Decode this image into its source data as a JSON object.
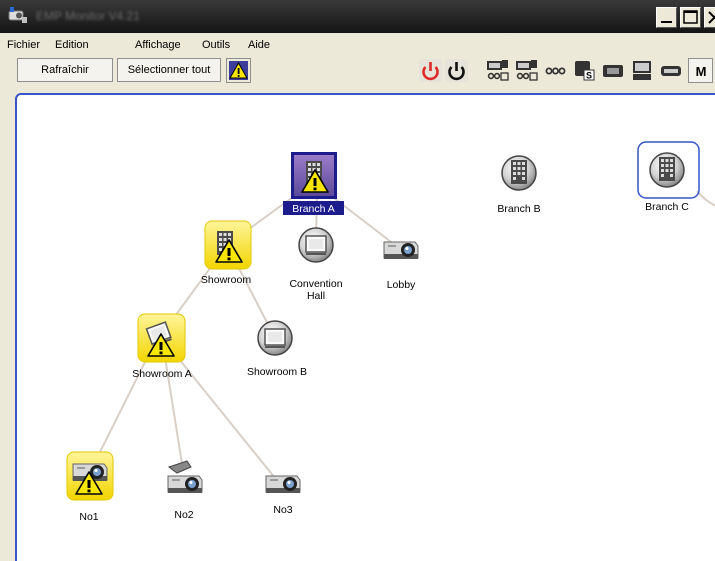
{
  "window": {
    "title": "EMP Monitor V4.21"
  },
  "menu": {
    "items": [
      "Fichier",
      "Edition",
      "Affichage",
      "Outils",
      "Aide"
    ]
  },
  "toolbar": {
    "refresh_label": "Rafraîchir",
    "select_all_label": "Sélectionner tout",
    "icons": [
      "warning-icon",
      "power-on-icon",
      "power-off-icon",
      "input1-icon",
      "input2-icon",
      "av-mute-icon",
      "source-s-icon",
      "source-video-icon",
      "source-computer-icon",
      "source-dvi-icon",
      "menu-m-icon"
    ]
  },
  "nodes": [
    {
      "id": "branch-a",
      "label": "Branch A",
      "kind": "group",
      "state": "warning-selected"
    },
    {
      "id": "branch-b",
      "label": "Branch B",
      "kind": "group",
      "state": "normal"
    },
    {
      "id": "branch-c",
      "label": "Branch C",
      "kind": "group",
      "state": "focused"
    },
    {
      "id": "showroom",
      "label": "Showroom",
      "kind": "group",
      "state": "warning"
    },
    {
      "id": "convention-hall",
      "label": "Convention Hall",
      "label_lines": [
        "Convention",
        "Hall"
      ],
      "kind": "screen",
      "state": "normal"
    },
    {
      "id": "lobby",
      "label": "Lobby",
      "kind": "projector",
      "state": "normal"
    },
    {
      "id": "showroom-a",
      "label": "Showroom A",
      "kind": "screen",
      "state": "warning"
    },
    {
      "id": "showroom-b",
      "label": "Showroom B",
      "kind": "screen",
      "state": "normal"
    },
    {
      "id": "no1",
      "label": "No1",
      "kind": "projector",
      "state": "warning"
    },
    {
      "id": "no2",
      "label": "No2",
      "kind": "projector-camera",
      "state": "normal"
    },
    {
      "id": "no3",
      "label": "No3",
      "kind": "projector",
      "state": "normal"
    }
  ],
  "edges": [
    [
      "branch-a",
      "showroom"
    ],
    [
      "branch-a",
      "convention-hall"
    ],
    [
      "branch-a",
      "lobby"
    ],
    [
      "showroom",
      "showroom-a"
    ],
    [
      "showroom",
      "showroom-b"
    ],
    [
      "showroom-a",
      "no1"
    ],
    [
      "showroom-a",
      "no2"
    ],
    [
      "showroom-a",
      "no3"
    ],
    [
      "branch-c",
      "offscreen"
    ]
  ],
  "colors": {
    "selection": "#1c1c8c",
    "warning_frame": "#f7e600",
    "focus_frame": "#3454c8",
    "edge": "#d9cfc7",
    "canvas_border": "#3a55c7",
    "power_on": "#e0292b"
  }
}
